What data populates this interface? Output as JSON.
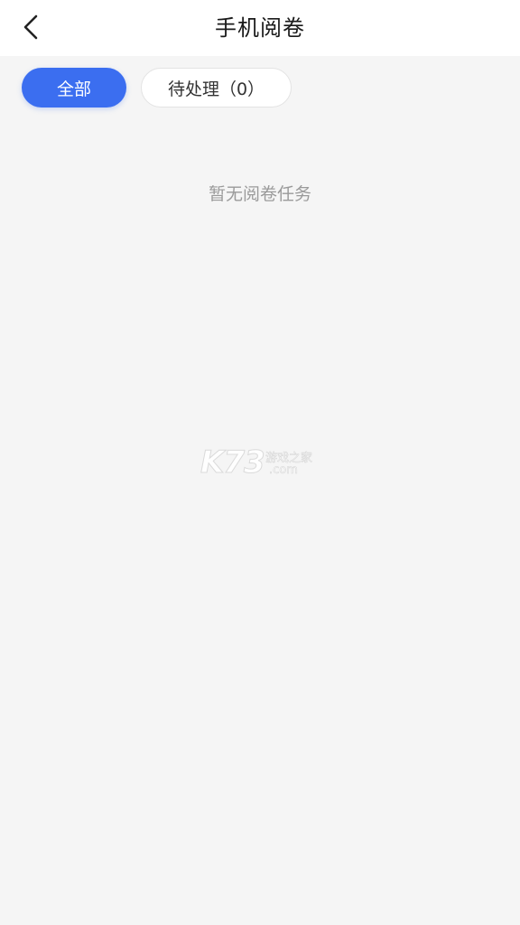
{
  "header": {
    "title": "手机阅卷",
    "back_icon": "chevron-left-icon"
  },
  "filters": {
    "all_label": "全部",
    "pending_label": "待处理（0）",
    "active_color": "#3b6ef0"
  },
  "empty_state": {
    "message": "暂无阅卷任务"
  },
  "watermark": {
    "main": "K73",
    "sub1": "游戏之家",
    "sub2": ".com"
  }
}
